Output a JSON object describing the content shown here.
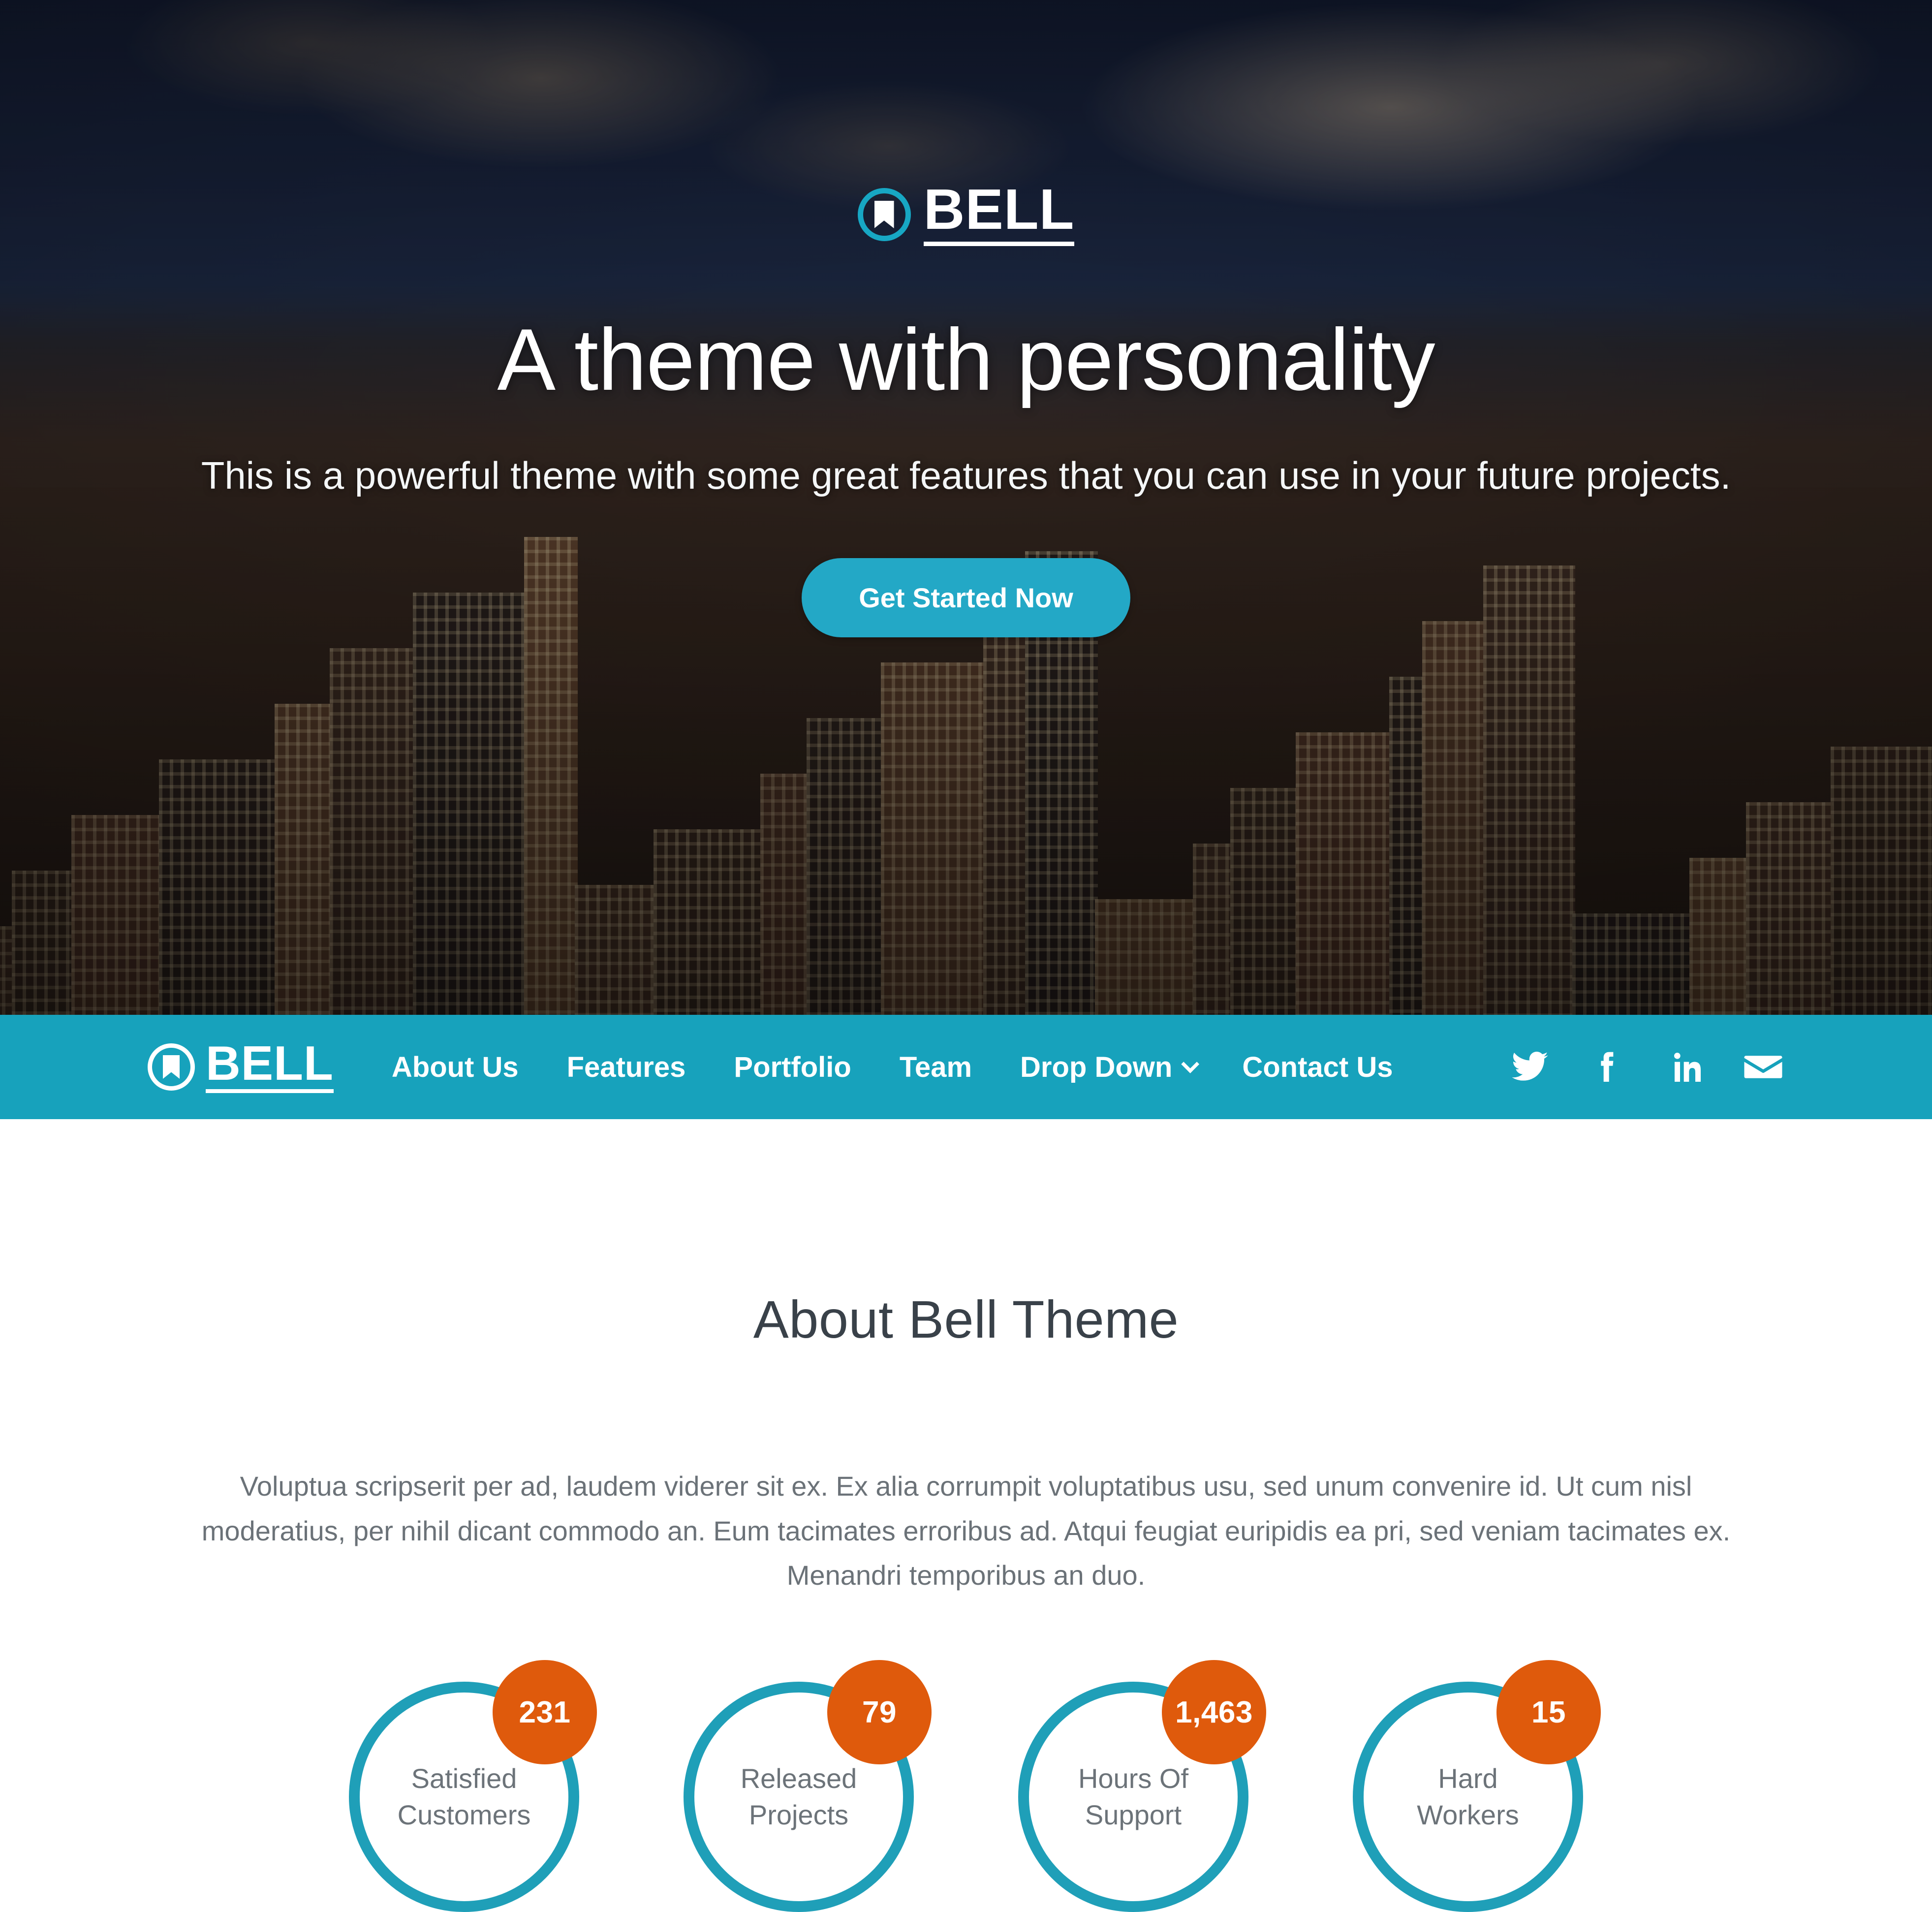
{
  "theme": {
    "accent_teal": "#17a2bc",
    "cta_teal": "#23a8c6",
    "ring_teal": "#1f9fb8",
    "badge_orange": "#df5a0c",
    "heading_color": "#394149",
    "body_color": "#6b7278"
  },
  "hero": {
    "logo_text": "BELL",
    "logo_icon": "bookmark-icon",
    "title": "A theme with personality",
    "subtitle": "This is a powerful theme with some great features that you can use in your future projects.",
    "cta_label": "Get Started Now"
  },
  "navbar": {
    "brand_text": "BELL",
    "brand_icon": "bookmark-icon",
    "links": [
      {
        "label": "About Us"
      },
      {
        "label": "Features"
      },
      {
        "label": "Portfolio"
      },
      {
        "label": "Team"
      },
      {
        "label": "Drop Down",
        "has_dropdown": true
      },
      {
        "label": "Contact Us"
      }
    ],
    "social": [
      {
        "name": "twitter-icon"
      },
      {
        "name": "facebook-icon"
      },
      {
        "name": "linkedin-icon"
      },
      {
        "name": "email-icon"
      }
    ]
  },
  "about": {
    "title": "About Bell Theme",
    "paragraph": "Voluptua scripserit per ad, laudem viderer sit ex. Ex alia corrumpit voluptatibus usu, sed unum convenire id. Ut cum nisl moderatius, per nihil dicant commodo an. Eum tacimates erroribus ad. Atqui feugiat euripidis ea pri, sed veniam tacimates ex. Menandri temporibus an duo.",
    "stats": [
      {
        "value": "231",
        "label_line1": "Satisfied",
        "label_line2": "Customers"
      },
      {
        "value": "79",
        "label_line1": "Released",
        "label_line2": "Projects"
      },
      {
        "value": "1,463",
        "label_line1": "Hours Of",
        "label_line2": "Support"
      },
      {
        "value": "15",
        "label_line1": "Hard",
        "label_line2": "Workers"
      }
    ]
  }
}
